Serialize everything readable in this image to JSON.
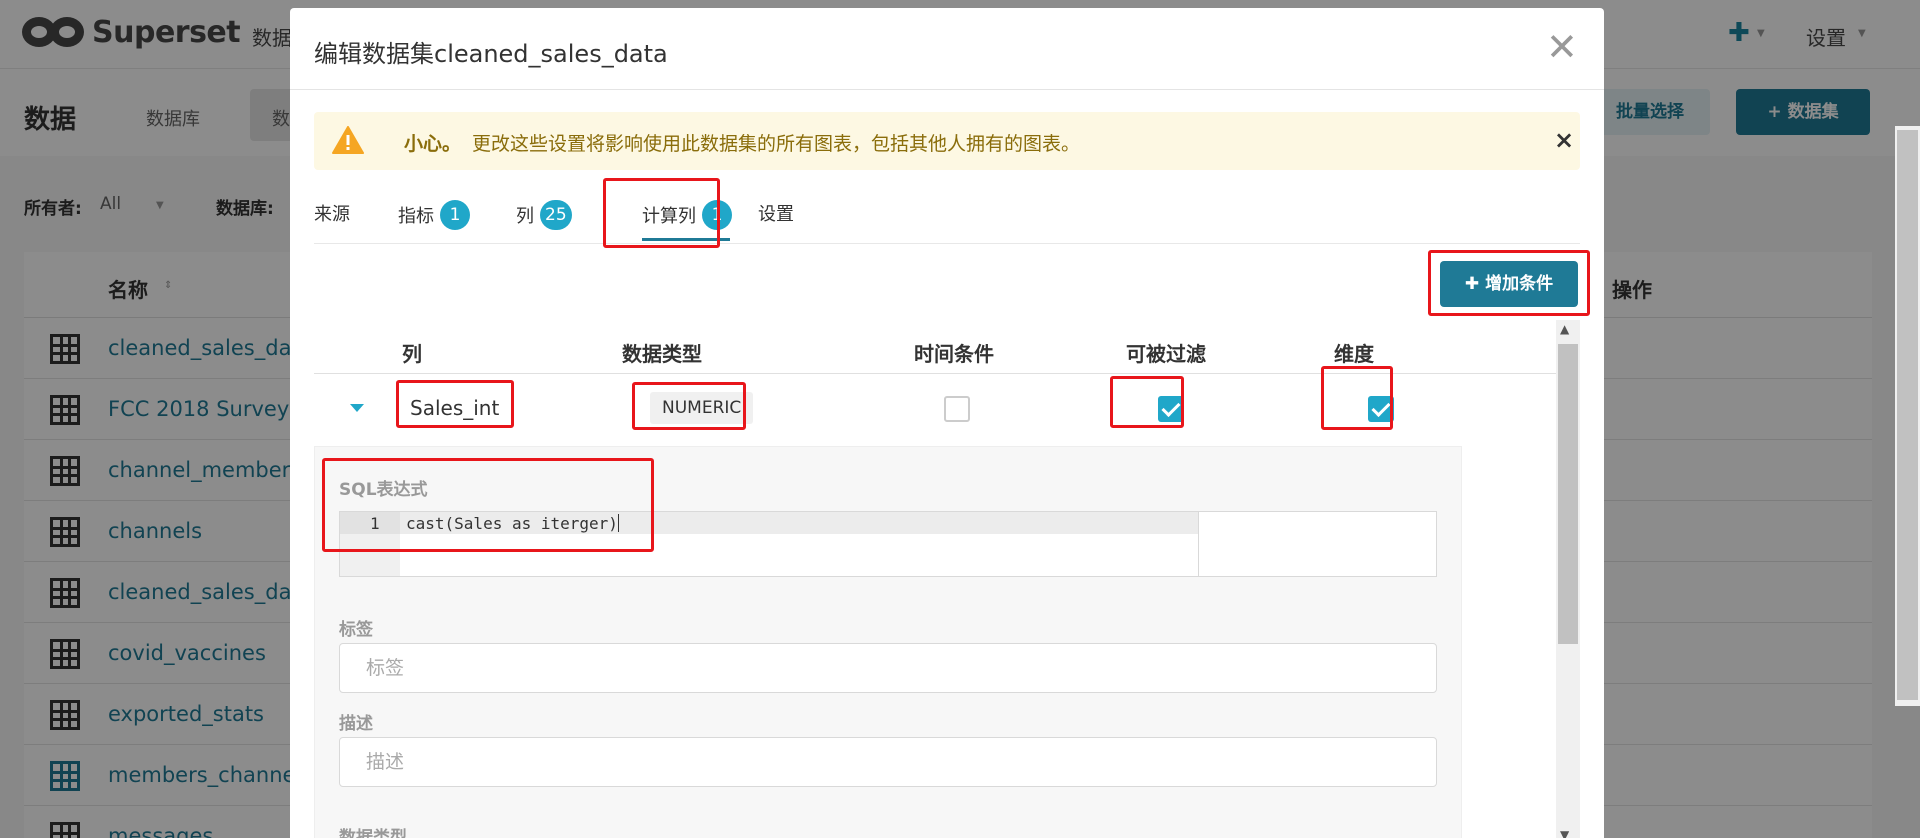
{
  "app": {
    "logo_text": "Superset",
    "nav_item": "数据",
    "settings_label": "设置"
  },
  "subheader": {
    "title": "数据",
    "db_link": "数据库",
    "pill_label": "数",
    "bulk_select": "批量选择",
    "add_dataset": "+ 数据集"
  },
  "filters": {
    "owner_label": "所有者:",
    "owner_value": "All",
    "database_label": "数据库:"
  },
  "list": {
    "col_name": "名称",
    "col_ops": "操作",
    "rows": [
      {
        "name": "cleaned_sales_dat"
      },
      {
        "name": "FCC 2018 Survey"
      },
      {
        "name": "channel_members"
      },
      {
        "name": "channels"
      },
      {
        "name": "cleaned_sales_dat"
      },
      {
        "name": "covid_vaccines"
      },
      {
        "name": "exported_stats"
      },
      {
        "name": "members_channel"
      },
      {
        "name": "messages"
      }
    ]
  },
  "modal": {
    "title": "编辑数据集cleaned_sales_data",
    "alert": {
      "strong": "小心。",
      "text": "更改这些设置将影响使用此数据集的所有图表，包括其他人拥有的图表。"
    },
    "tabs": [
      {
        "label": "来源"
      },
      {
        "label": "指标",
        "count": "1"
      },
      {
        "label": "列",
        "count": "25"
      },
      {
        "label": "计算列",
        "count": "1",
        "active": true
      },
      {
        "label": "设置"
      }
    ],
    "add_button": "增加条件",
    "grid_headers": {
      "column": "列",
      "data_type": "数据类型",
      "temporal": "时间条件",
      "filterable": "可被过滤",
      "dimension": "维度"
    },
    "row": {
      "column_name": "Sales_int",
      "data_type": "NUMERIC",
      "is_temporal": false,
      "filterable": true,
      "dimension": true
    },
    "details": {
      "sql_label": "SQL表达式",
      "line_number": "1",
      "sql_expression": "cast(Sales as iterger)",
      "label_label": "标签",
      "label_placeholder": "标签",
      "desc_label": "描述",
      "desc_placeholder": "描述",
      "data_type_label": "数据类型"
    }
  },
  "colors": {
    "accent": "#1f7a96",
    "badge": "#20a7c9",
    "warning_bg": "#fdf8e3",
    "warning_text": "#8a6d0b",
    "annotation": "#e8161b"
  }
}
